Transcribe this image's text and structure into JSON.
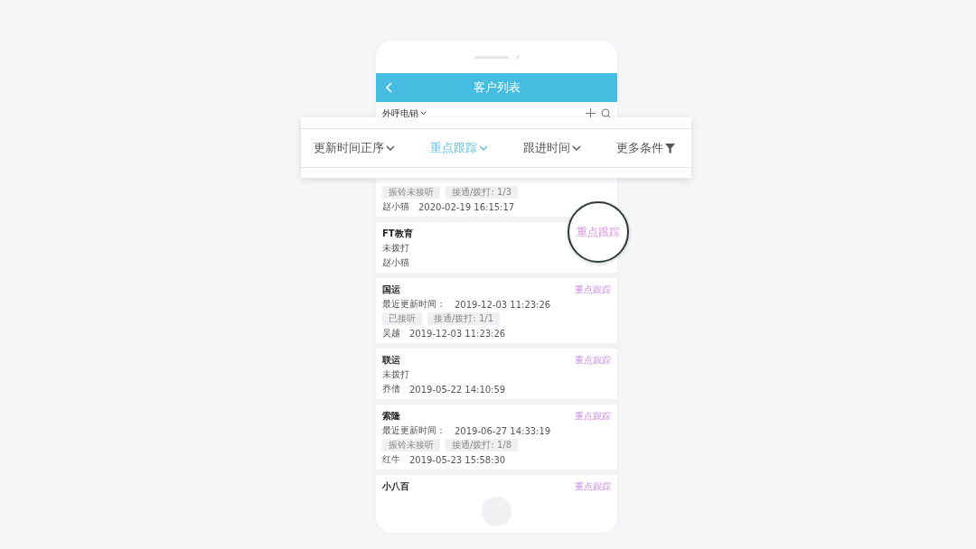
{
  "header": {
    "title": "客户列表"
  },
  "subbar": {
    "label": "外呼电销"
  },
  "filters": [
    {
      "label": "更新时间正序",
      "selected": false,
      "kind": "dropdown"
    },
    {
      "label": "重点跟踪",
      "selected": true,
      "kind": "dropdown"
    },
    {
      "label": "跟进时间",
      "selected": false,
      "kind": "dropdown"
    },
    {
      "label": "更多条件",
      "selected": false,
      "kind": "filter"
    }
  ],
  "customers": [
    {
      "chips": [
        "振铃未接听",
        "接通/拨打: 1/3"
      ],
      "owner": "赵小猫",
      "time": "2020-02-19 16:15:17"
    },
    {
      "name": "FT教育",
      "status": "未拨打",
      "owner": "赵小猫"
    },
    {
      "name": "国运",
      "tag": "重点跟踪",
      "updated_label": "最近更新时间：",
      "updated": "2019-12-03 11:23:26",
      "chips": [
        "已接听",
        "接通/拨打: 1/1"
      ],
      "owner": "吴越",
      "time": "2019-12-03 11:23:26"
    },
    {
      "name": "联运",
      "tag": "重点跟踪",
      "status": "未拨打",
      "owner": "乔倩",
      "time": "2019-05-22 14:10:59"
    },
    {
      "name": "索隆",
      "tag": "重点跟踪",
      "updated_label": "最近更新时间：",
      "updated": "2019-06-27 14:33:19",
      "chips": [
        "振铃未接听",
        "接通/拨打: 1/8"
      ],
      "owner": "红牛",
      "time": "2019-05-23 15:58:30"
    },
    {
      "name": "小八百",
      "tag": "重点跟踪"
    }
  ],
  "magnifier": {
    "label": "重点跟踪"
  }
}
